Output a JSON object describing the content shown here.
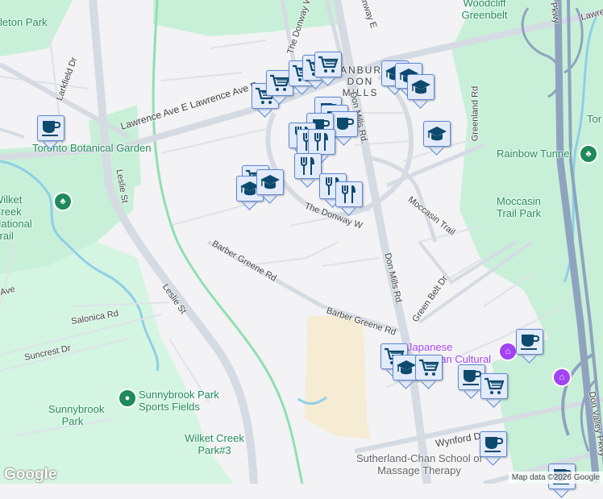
{
  "labels": {
    "places": {
      "edwards": "leton Park",
      "botanical": "Toronto Botanical Garden",
      "wilket_trail": "Wilket Creek National Trail",
      "woodcliff": "Woodcliff Greenbelt",
      "rainbow": "Rainbow Tunnel",
      "moccasin_park": "Moccasin Trail Park",
      "sunnybrook": "Sunnybrook Park Sports Fields",
      "sunnybrook_park": "Sunnybrook Park",
      "wilket3": "Wilket Creek Park#3",
      "tor": "Tor",
      "area": "BANBURY-DON MILLS",
      "jccc": "Japanese Canadian Cultural Centre",
      "sutherland": "Sutherland-Chan School of Massage Therapy"
    },
    "roads": {
      "larkfield": "Larkfield Dr",
      "lawrence": "Lawrence Ave E Lawrence Ave E",
      "lawrence_r": "Lawrence",
      "leslie1": "Leslie St",
      "leslie2": "Leslie St",
      "donway": "The Donway W",
      "donway_top": "The Donway W",
      "donway_e": "Donway E",
      "donmills1": "Don Mills Rd.",
      "donmills2": "Don Mills Rd.",
      "greenland": "Greenland Rd",
      "moccasin": "Moccasin Trail",
      "barber1": "Barber Greene Rd",
      "barber2": "Barber Greene Rd",
      "greenbelt": "Green Belt Dr",
      "salonica": "Salonica Rd",
      "suncrest": "Suncrest Dr",
      "ave": "Ave",
      "wynford": "Wynford Dr",
      "dvp": "Don Valley Pkwy",
      "pkwy": "Pkwy"
    }
  },
  "markers": [
    "cart",
    "cart",
    "cart",
    "cart",
    "cart",
    "coffee",
    "grad",
    "grad",
    "grad",
    "grad",
    "cup",
    "cup",
    "cup",
    "cup",
    "fork",
    "fork",
    "fork",
    "fork",
    "fork",
    "fork",
    "cart",
    "grad",
    "grad",
    "cart",
    "grad",
    "cart",
    "coffee",
    "cart",
    "coffee",
    "coffee",
    "coffee"
  ],
  "branding": {
    "logo": "Google",
    "attribution": "Map data ©2026 Google"
  },
  "colors": {
    "marker_icon": "#0d4a6e",
    "park": "#c8f0d8",
    "road": "#d5dbe3",
    "highway": "#8fa3bf",
    "poi": "#a142f4"
  }
}
